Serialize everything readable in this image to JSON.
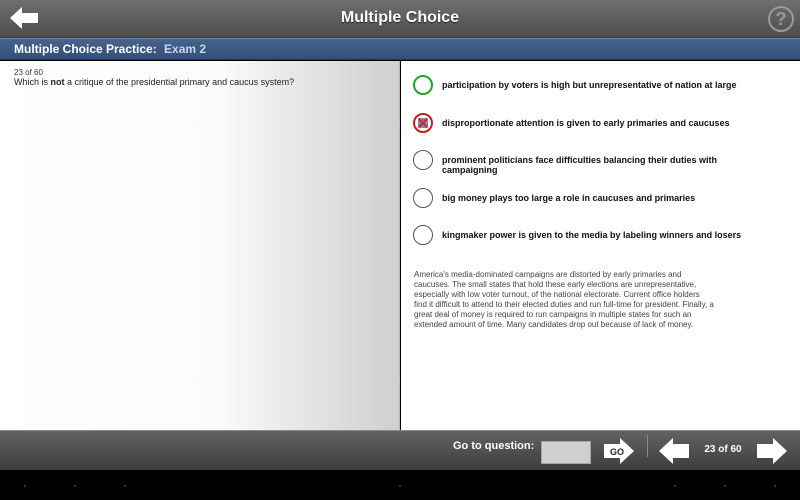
{
  "header": {
    "title": "Multiple Choice",
    "help_icon": "?",
    "back_icon": "back-arrow-icon"
  },
  "subheader": {
    "label": "Multiple Choice Practice:",
    "exam": "Exam 2"
  },
  "question": {
    "counter": "23 of 60",
    "text_before": "Which is ",
    "text_bold": "not",
    "text_after": " a critique of the presidential primary and caucus system?"
  },
  "answers": [
    {
      "text": "participation by voters is high but unrepresentative of nation at large",
      "state": "correct"
    },
    {
      "text": "disproportionate attention is given to early primaries and caucuses",
      "state": "wrong"
    },
    {
      "text": "prominent politicians face difficulties balancing their duties with campaigning",
      "state": "none"
    },
    {
      "text": "big money plays too large a role in caucuses and primaries",
      "state": "none"
    },
    {
      "text": "kingmaker power is given to the media by labeling winners and losers",
      "state": "none"
    }
  ],
  "explanation": "America's media-dominated campaigns are distorted by early primaries and caucuses.  The small states that hold these early elections are unrepresentative, especially with low voter turnout, of the national electorate.  Current office holders find it difficult to attend to their elected duties and run full-time for president.  Finally, a great deal of money is required to run campaigns in multiple states for such an extended amount of time.  Many candidates drop out because of lack of money.",
  "footer": {
    "goto_label": "Go to question:",
    "goto_value": "",
    "go_label": "GO",
    "page_counter": "23 of 60"
  },
  "colors": {
    "correct": "#1fa52a",
    "wrong": "#c81b1b",
    "header_blue": "#3a5680"
  }
}
